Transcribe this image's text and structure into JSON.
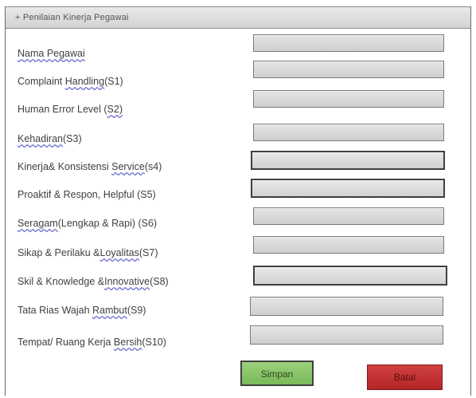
{
  "panel": {
    "title": "+ Penilaian Kinerja Pegawai"
  },
  "fields": [
    {
      "label_pre": "",
      "label_u": "Nama  Pegawai",
      "label_post": ""
    },
    {
      "label_pre": "Complaint ",
      "label_u": "Handling",
      "label_post": "(S1)"
    },
    {
      "label_pre": "Human Error Level (",
      "label_u": "S2)",
      "label_post": ""
    },
    {
      "label_pre": "",
      "label_u": "Kehadiran",
      "label_post": "(S3)"
    },
    {
      "label_pre": "Kinerja& Konsistensi ",
      "label_u": "Service",
      "label_post": "(s4)"
    },
    {
      "label_pre": "Proaktif & Respon, Helpful (S5)",
      "label_u": "",
      "label_post": ""
    },
    {
      "label_pre": "",
      "label_u": "Seragam",
      "label_post": "(Lengkap & Rapi) (S6)"
    },
    {
      "label_pre": "Sikap & Perilaku &",
      "label_u": "Loyalitas",
      "label_post": "(S7)"
    },
    {
      "label_pre": "Skil & Knowledge &",
      "label_u": "Innovative",
      "label_post": "(S8)"
    },
    {
      "label_pre": "Tata Rias Wajah ",
      "label_u": "Rambut",
      "label_post": "(S9)"
    },
    {
      "label_pre": "Tempat/ Ruang Kerja ",
      "label_u": "Bersih",
      "label_post": "(S10)"
    }
  ],
  "buttons": {
    "save_label": "Simpan",
    "cancel_label": "Batal"
  },
  "colors": {
    "save": "#8cc46b",
    "cancel": "#c63232",
    "field": "#d9d9d9"
  }
}
